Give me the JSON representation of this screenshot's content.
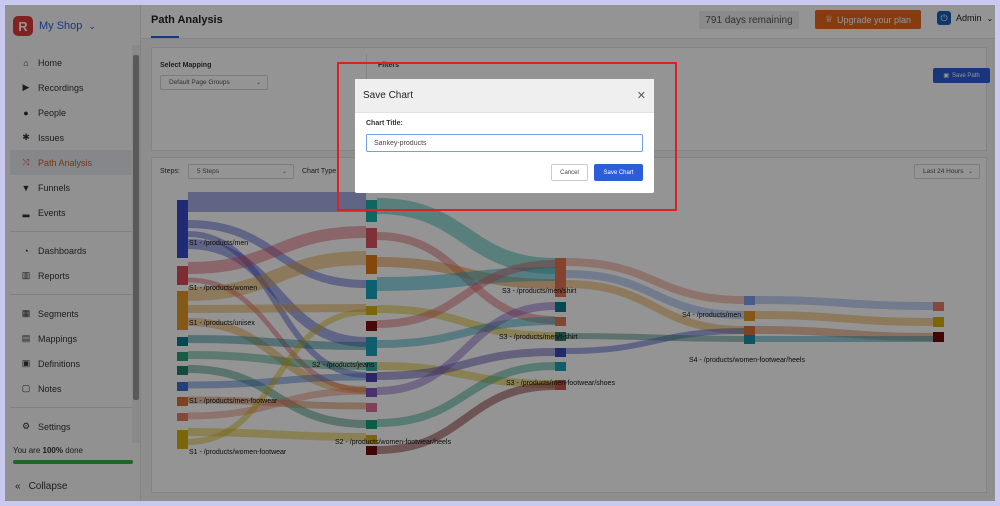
{
  "brand": {
    "name": "My Shop",
    "logo_letter": "R"
  },
  "sidebar": {
    "items": [
      {
        "label": "Home",
        "icon": "home-icon"
      },
      {
        "label": "Recordings",
        "icon": "video-icon"
      },
      {
        "label": "People",
        "icon": "person-icon"
      },
      {
        "label": "Issues",
        "icon": "bug-icon"
      },
      {
        "label": "Path Analysis",
        "icon": "shuffle-icon",
        "active": true
      },
      {
        "label": "Funnels",
        "icon": "funnel-icon"
      },
      {
        "label": "Events",
        "icon": "signal-icon"
      },
      {
        "label": "Dashboards",
        "icon": "dashboard-icon"
      },
      {
        "label": "Reports",
        "icon": "bar-chart-icon"
      },
      {
        "label": "Segments",
        "icon": "grid-icon"
      },
      {
        "label": "Mappings",
        "icon": "map-icon"
      },
      {
        "label": "Definitions",
        "icon": "book-icon"
      },
      {
        "label": "Notes",
        "icon": "note-icon"
      },
      {
        "label": "Settings",
        "icon": "gear-icon"
      }
    ],
    "progress_prefix": "You are ",
    "progress_value": "100%",
    "progress_suffix": " done",
    "progress_fraction": 1.0,
    "collapse_label": "Collapse"
  },
  "header": {
    "title": "Path Analysis",
    "days_remaining": "791 days remaining",
    "upgrade_label": "Upgrade your plan",
    "user": "Admin"
  },
  "controls": {
    "mapping_label": "Select Mapping",
    "mapping_value": "Default Page Groups",
    "filters_label": "Filters",
    "save_path_label": "Save Path",
    "steps_label": "Steps:",
    "steps_value": "5 Steps",
    "chart_type_label": "Chart Type",
    "range_value": "Last 24 Hours"
  },
  "modal": {
    "title": "Save Chart",
    "field_label": "Chart Title:",
    "field_value": "Sankey-products",
    "cancel_label": "Cancel",
    "save_label": "Save Chart"
  },
  "sankey": {
    "node_labels": [
      "S1 - /products/men",
      "S1 - /products/women",
      "S1 - /products/unisex",
      "S1 - /products/men-footwear",
      "S1 - /products/women-footwear",
      "S2 - /products/jeans",
      "S2 - /products/women-footwear/heels",
      "S3 - /products/men/shirt",
      "S3 - /products/men/t-shirt",
      "S3 - /products/men-footwear/shoes",
      "S4 - /products/men",
      "S4 - /products/women-footwear/heels"
    ]
  }
}
